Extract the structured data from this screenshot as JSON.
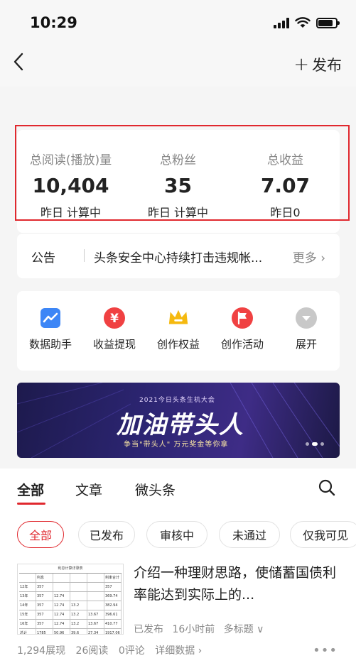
{
  "status_bar": {
    "time": "10:29",
    "battery_level": 0.85
  },
  "nav": {
    "publish_plus": "+",
    "publish_label": "发布"
  },
  "stats": [
    {
      "label": "总阅读(播放)量",
      "value": "10,404",
      "sub": "昨日 计算中"
    },
    {
      "label": "总粉丝",
      "value": "35",
      "sub": "昨日 计算中"
    },
    {
      "label": "总收益",
      "value": "7.07",
      "sub": "昨日0"
    }
  ],
  "notice": {
    "label": "公告",
    "text": "头条安全中心持续打击违规帐...",
    "more": "更多 ›"
  },
  "tools": [
    {
      "label": "数据助手",
      "icon": "chart-icon",
      "color": "#3d86f6"
    },
    {
      "label": "收益提现",
      "icon": "yen-icon",
      "color": "#f04142"
    },
    {
      "label": "创作权益",
      "icon": "crown-icon",
      "color": "#f5b90f"
    },
    {
      "label": "创作活动",
      "icon": "flag-icon",
      "color": "#f04142"
    },
    {
      "label": "展开",
      "icon": "chevron-down-icon",
      "color": "#c8c8c8"
    }
  ],
  "banner": {
    "subtitle": "2021今日头条生机大会",
    "title": "加油带头人",
    "tagline": "争当\"带头人\"  万元奖金等你拿"
  },
  "content_tabs": [
    {
      "label": "全部",
      "active": true
    },
    {
      "label": "文章",
      "active": false
    },
    {
      "label": "微头条",
      "active": false
    }
  ],
  "filters": [
    {
      "label": "全部",
      "active": true
    },
    {
      "label": "已发布",
      "active": false
    },
    {
      "label": "审核中",
      "active": false
    },
    {
      "label": "未通过",
      "active": false
    },
    {
      "label": "仅我可见",
      "active": false
    }
  ],
  "article": {
    "title": "介绍一种理财思路，使储蓄国债利率能达到实际上的...",
    "status": "已发布",
    "time": "16小时前",
    "tag": "多标题 ∨",
    "thumb_title": "利息计算详录表",
    "thumb_rows": [
      [
        "",
        "利息（元）",
        "",
        "",
        "",
        "利率合计（元）"
      ],
      [
        "12年",
        "357",
        "",
        "",
        "",
        "357"
      ],
      [
        "13年",
        "357",
        "12.74",
        "",
        "",
        "369.74"
      ],
      [
        "14年",
        "357",
        "12.74",
        "13.2",
        "",
        "382.94"
      ],
      [
        "15年",
        "357",
        "12.74",
        "13.2",
        "13.67",
        "396.61"
      ],
      [
        "16年",
        "357",
        "12.74",
        "13.2",
        "13.67",
        "410.77"
      ],
      [
        "总计",
        "1785",
        "50.96",
        "39.6",
        "27.34",
        "1917.06"
      ]
    ],
    "impressions": "1,294展现",
    "reads": "26阅读",
    "comments": "0评论",
    "details": "详细数据 ›"
  }
}
